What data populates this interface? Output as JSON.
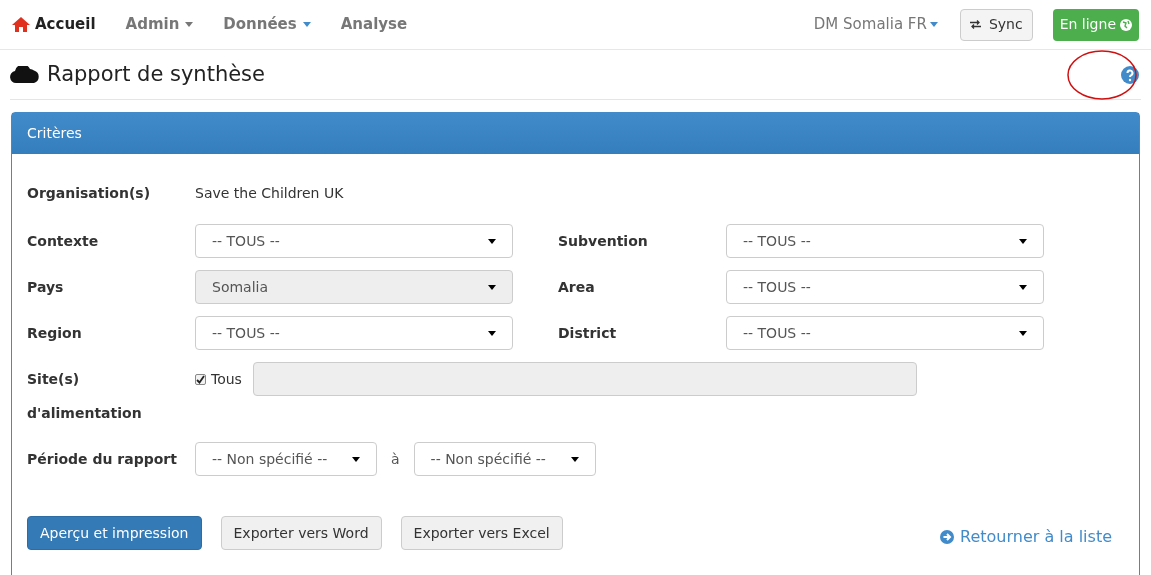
{
  "navbar": {
    "items": [
      {
        "label": "Accueil",
        "kind": "home",
        "selected": true
      },
      {
        "label": "Admin",
        "kind": "dropdown",
        "selected": false
      },
      {
        "label": "Données",
        "kind": "dropdown",
        "selected": false
      },
      {
        "label": "Analyse",
        "kind": "link",
        "selected": false
      }
    ],
    "user_menu": "DM Somalia FR",
    "sync_button": "Sync",
    "status_button": "En ligne"
  },
  "page_title": "Rapport de synthèse",
  "panel": {
    "title": "Critères",
    "organisation": {
      "label": "Organisation(s)",
      "value": "Save the Children UK"
    },
    "fields": [
      {
        "label": "Contexte",
        "value": "-- TOUS --",
        "disabled": false
      },
      {
        "label": "Subvention",
        "value": "-- TOUS --",
        "disabled": false
      },
      {
        "label": "Pays",
        "value": "Somalia",
        "disabled": true
      },
      {
        "label": "Area",
        "value": "-- TOUS --",
        "disabled": false
      },
      {
        "label": "Region",
        "value": "-- TOUS --",
        "disabled": false
      },
      {
        "label": "District",
        "value": "-- TOUS --",
        "disabled": false
      }
    ],
    "sites": {
      "label_line1": "Site(s)",
      "label_line2": "d'alimentation",
      "checkbox_label": "Tous",
      "checked": true
    },
    "period": {
      "label": "Période du rapport",
      "from": "-- Non spécifié --",
      "separator": "à",
      "to": "-- Non spécifié --"
    },
    "buttons": [
      {
        "label": "Aperçu et impression",
        "kind": "primary"
      },
      {
        "label": "Exporter vers Word",
        "kind": "default"
      },
      {
        "label": "Exporter vers Excel",
        "kind": "default"
      }
    ],
    "back_link": "Retourner à la liste"
  }
}
